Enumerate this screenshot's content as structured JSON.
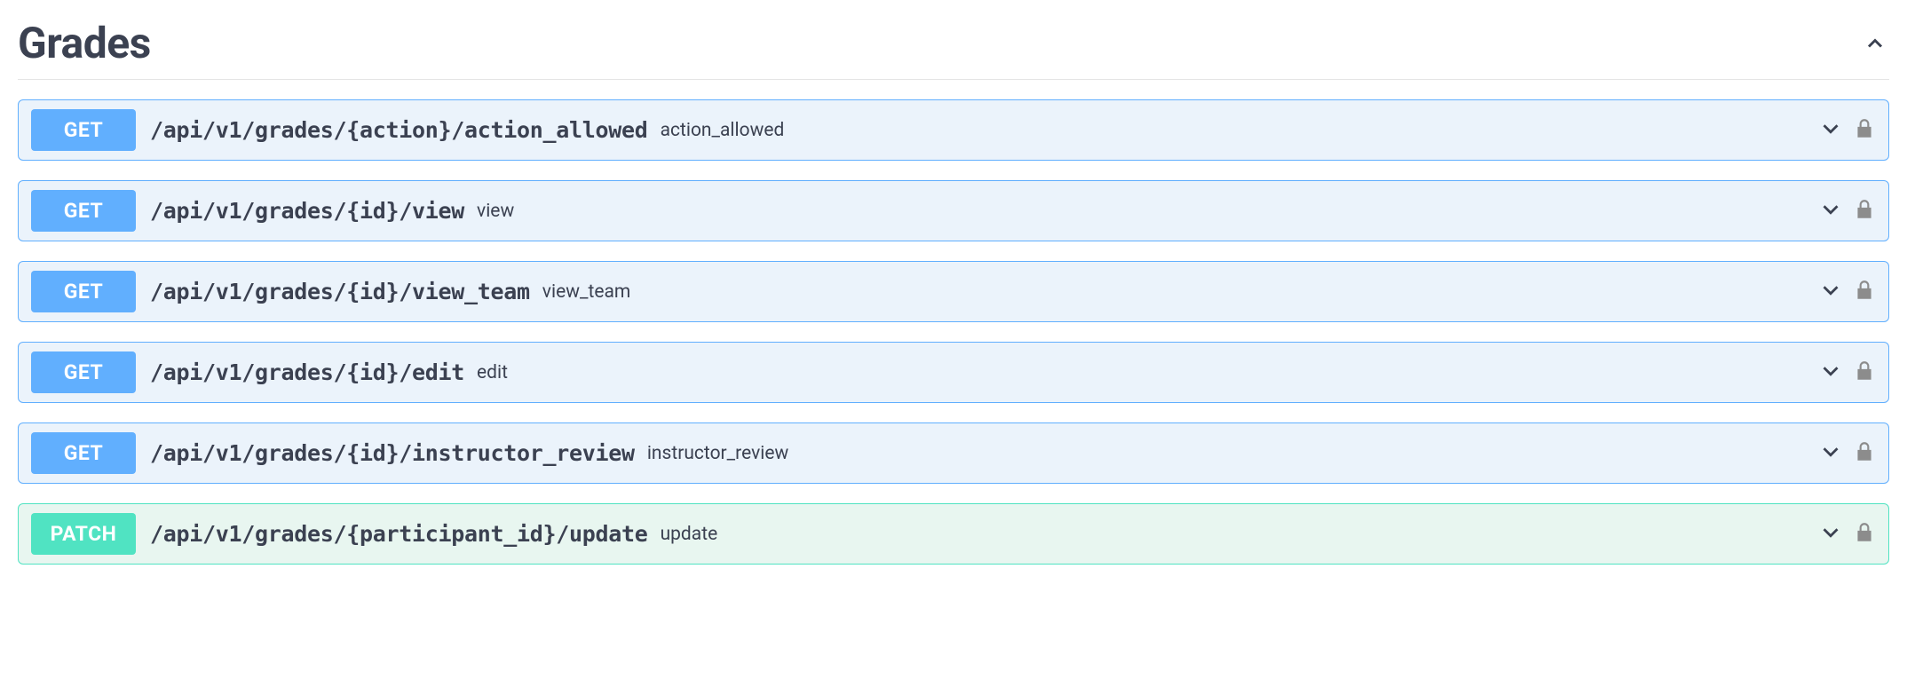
{
  "section": {
    "title": "Grades"
  },
  "endpoints": [
    {
      "method": "GET",
      "badgeClass": "badge-get",
      "blockClass": "op-get",
      "path": "/api/v1/grades/{action}/action_allowed",
      "desc": "action_allowed"
    },
    {
      "method": "GET",
      "badgeClass": "badge-get",
      "blockClass": "op-get",
      "path": "/api/v1/grades/{id}/view",
      "desc": "view"
    },
    {
      "method": "GET",
      "badgeClass": "badge-get",
      "blockClass": "op-get",
      "path": "/api/v1/grades/{id}/view_team",
      "desc": "view_team"
    },
    {
      "method": "GET",
      "badgeClass": "badge-get",
      "blockClass": "op-get",
      "path": "/api/v1/grades/{id}/edit",
      "desc": "edit"
    },
    {
      "method": "GET",
      "badgeClass": "badge-get",
      "blockClass": "op-get",
      "path": "/api/v1/grades/{id}/instructor_review",
      "desc": "instructor_review"
    },
    {
      "method": "PATCH",
      "badgeClass": "badge-patch",
      "blockClass": "op-patch",
      "path": "/api/v1/grades/{participant_id}/update",
      "desc": "update"
    }
  ]
}
